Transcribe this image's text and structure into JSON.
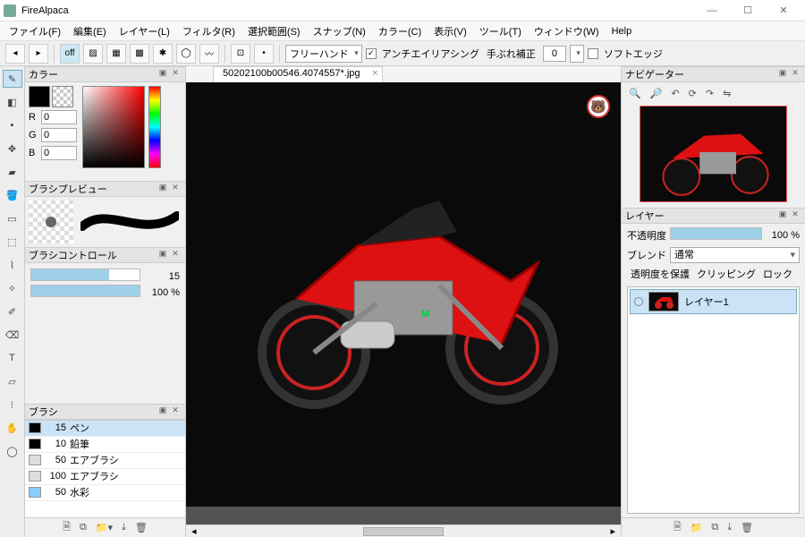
{
  "window": {
    "title": "FireAlpaca"
  },
  "menu": [
    "ファイル(F)",
    "編集(E)",
    "レイヤー(L)",
    "フィルタ(R)",
    "選択範囲(S)",
    "スナップ(N)",
    "カラー(C)",
    "表示(V)",
    "ツール(T)",
    "ウィンドウ(W)",
    "Help"
  ],
  "toolbar": {
    "mode": "フリーハンド",
    "aa_label": "アンチエイリアシング",
    "aa_checked": "✓",
    "tebure_label": "手ぶれ補正",
    "tebure_value": "0",
    "softedge_label": "ソフトエッジ",
    "softedge_checked": ""
  },
  "panels": {
    "color": {
      "title": "カラー",
      "r": "0",
      "g": "0",
      "b": "0",
      "r_label": "R",
      "g_label": "G",
      "b_label": "B"
    },
    "brushprev": {
      "title": "ブラシプレビュー"
    },
    "brushctrl": {
      "title": "ブラシコントロール",
      "size": "15",
      "opacity": "100 %"
    },
    "brushes": {
      "title": "ブラシ",
      "items": [
        {
          "size": "15",
          "name": "ペン",
          "color": "#000",
          "sel": true
        },
        {
          "size": "10",
          "name": "鉛筆",
          "color": "#000"
        },
        {
          "size": "50",
          "name": "エアブラシ",
          "color": "#ddd"
        },
        {
          "size": "100",
          "name": "エアブラシ",
          "color": "#ddd"
        },
        {
          "size": "50",
          "name": "水彩",
          "color": "#8cf"
        }
      ]
    }
  },
  "canvas": {
    "filename": "50202100b00546.4074557*.jpg"
  },
  "nav": {
    "title": "ナビゲーター"
  },
  "layers": {
    "title": "レイヤー",
    "opacity_label": "不透明度",
    "opacity_value": "100 %",
    "blend_label": "ブレンド",
    "blend_value": "通常",
    "protect_alpha": "透明度を保護",
    "clipping": "クリッピング",
    "lock": "ロック",
    "items": [
      {
        "name": "レイヤー1"
      }
    ]
  }
}
